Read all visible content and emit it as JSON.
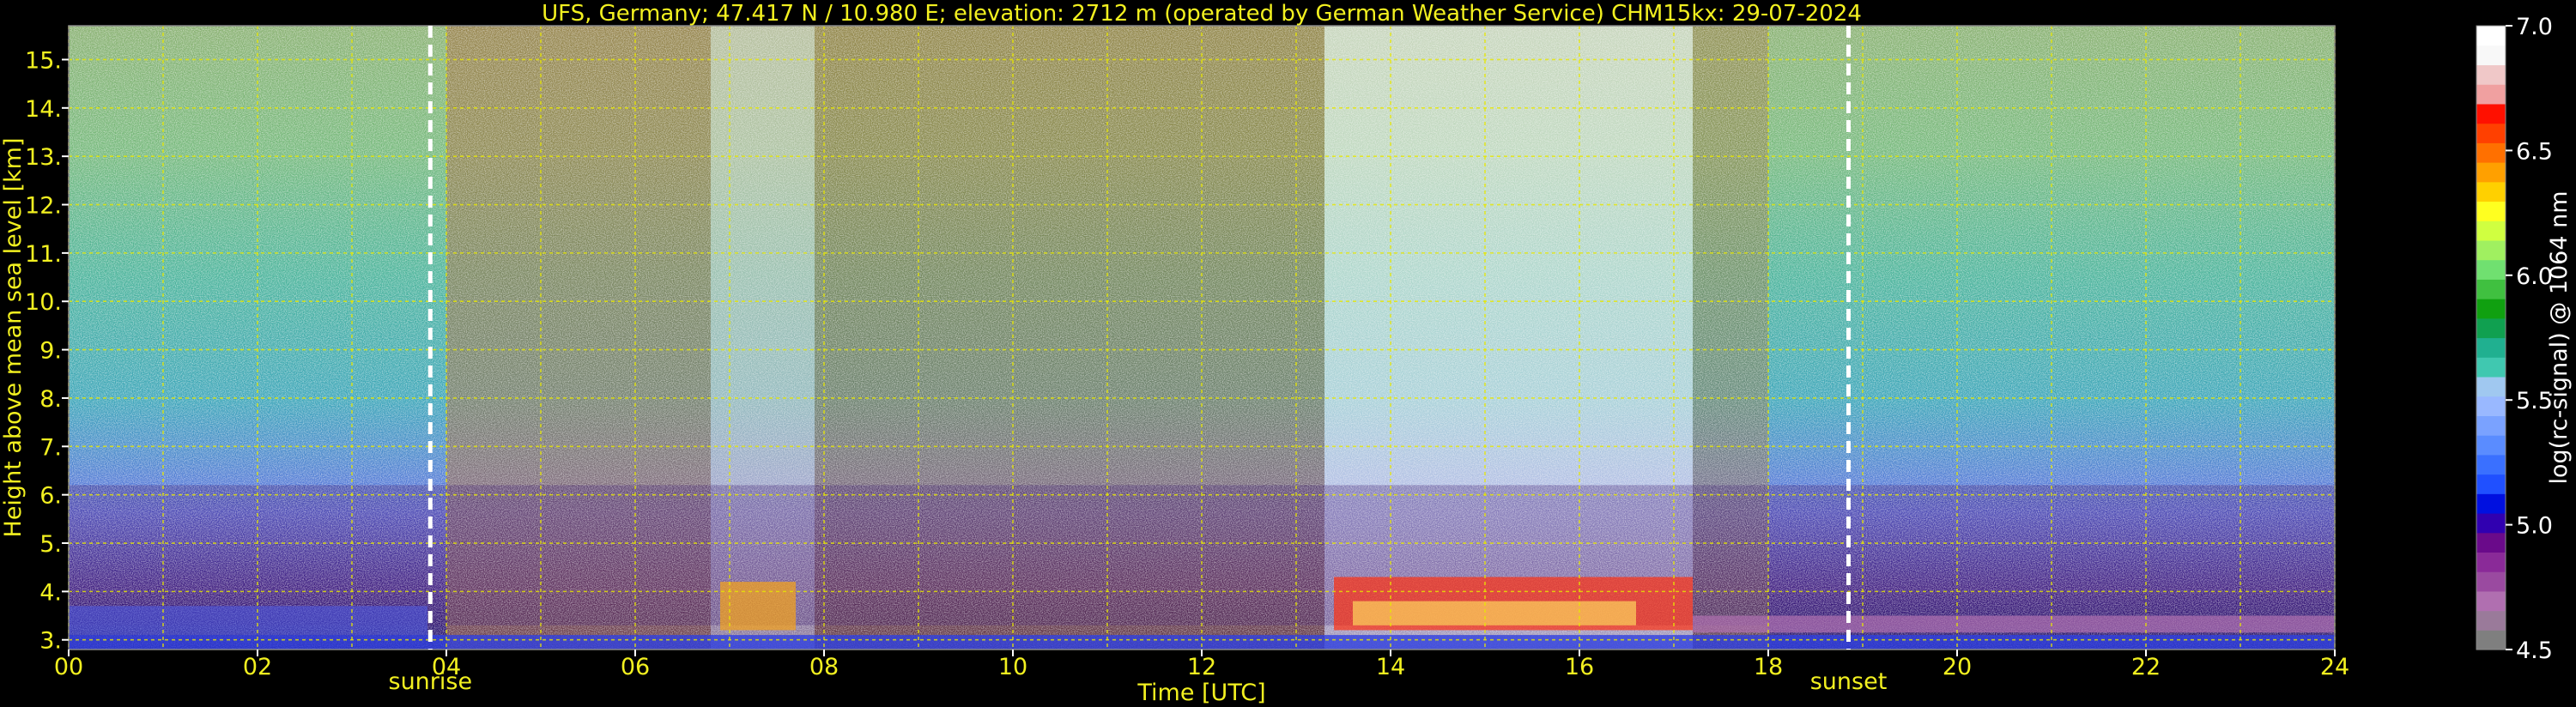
{
  "title": "UFS, Germany; 47.417 N / 10.980 E; elevation: 2712 m  (operated by German Weather Service)    CHM15kx: 29-07-2024",
  "chart_data": {
    "type": "heatmap",
    "title": "UFS, Germany; 47.417 N / 10.980 E; elevation: 2712 m  (operated by German Weather Service)    CHM15kx: 29-07-2024",
    "xlabel": "Time [UTC]",
    "ylabel": "Height above mean sea level [km]",
    "xlim": [
      0,
      24
    ],
    "ylim": [
      2.8,
      15.7
    ],
    "x_ticks": [
      0,
      2,
      4,
      6,
      8,
      10,
      12,
      14,
      16,
      18,
      20,
      22,
      24
    ],
    "x_tick_labels": [
      "00",
      "02",
      "04",
      "06",
      "08",
      "10",
      "12",
      "14",
      "16",
      "18",
      "20",
      "22",
      "24"
    ],
    "y_ticks": [
      3,
      4,
      5,
      6,
      7,
      8,
      9,
      10,
      11,
      12,
      13,
      14,
      15
    ],
    "y_tick_labels": [
      "3.",
      "4.",
      "5.",
      "6.",
      "7.",
      "8.",
      "9.",
      "10.",
      "11.",
      "12.",
      "13.",
      "14.",
      "15."
    ],
    "grid": true,
    "grid_color": "#e8e800",
    "markers": [
      {
        "label": "sunrise",
        "x": 3.83
      },
      {
        "label": "sunset",
        "x": 18.85
      }
    ],
    "colorbar": {
      "label": "log(rc-signal) @ 1064 nm",
      "range": [
        4.5,
        7.0
      ],
      "tick_values": [
        4.5,
        5.0,
        5.5,
        6.0,
        6.5,
        7.0
      ],
      "tick_labels": [
        "4.5",
        "5.0",
        "5.5",
        "6.0",
        "6.5",
        "7.0"
      ],
      "colors": [
        "#7f7f7f",
        "#9a7a9a",
        "#b06fb0",
        "#9a4aa0",
        "#8a2a98",
        "#6a0a8a",
        "#3000b0",
        "#0010e0",
        "#2050ff",
        "#3a70ff",
        "#5a8cff",
        "#7aa2ff",
        "#99b8ff",
        "#a0c8f0",
        "#40c8b0",
        "#20b090",
        "#10a050",
        "#10a010",
        "#40c040",
        "#70e070",
        "#a0f060",
        "#d0ff40",
        "#ffff20",
        "#ffd000",
        "#ffa000",
        "#ff7000",
        "#ff4000",
        "#ff1000",
        "#f0a0a0",
        "#f0c8c8",
        "#f8f8f8",
        "#ffffff"
      ]
    }
  }
}
